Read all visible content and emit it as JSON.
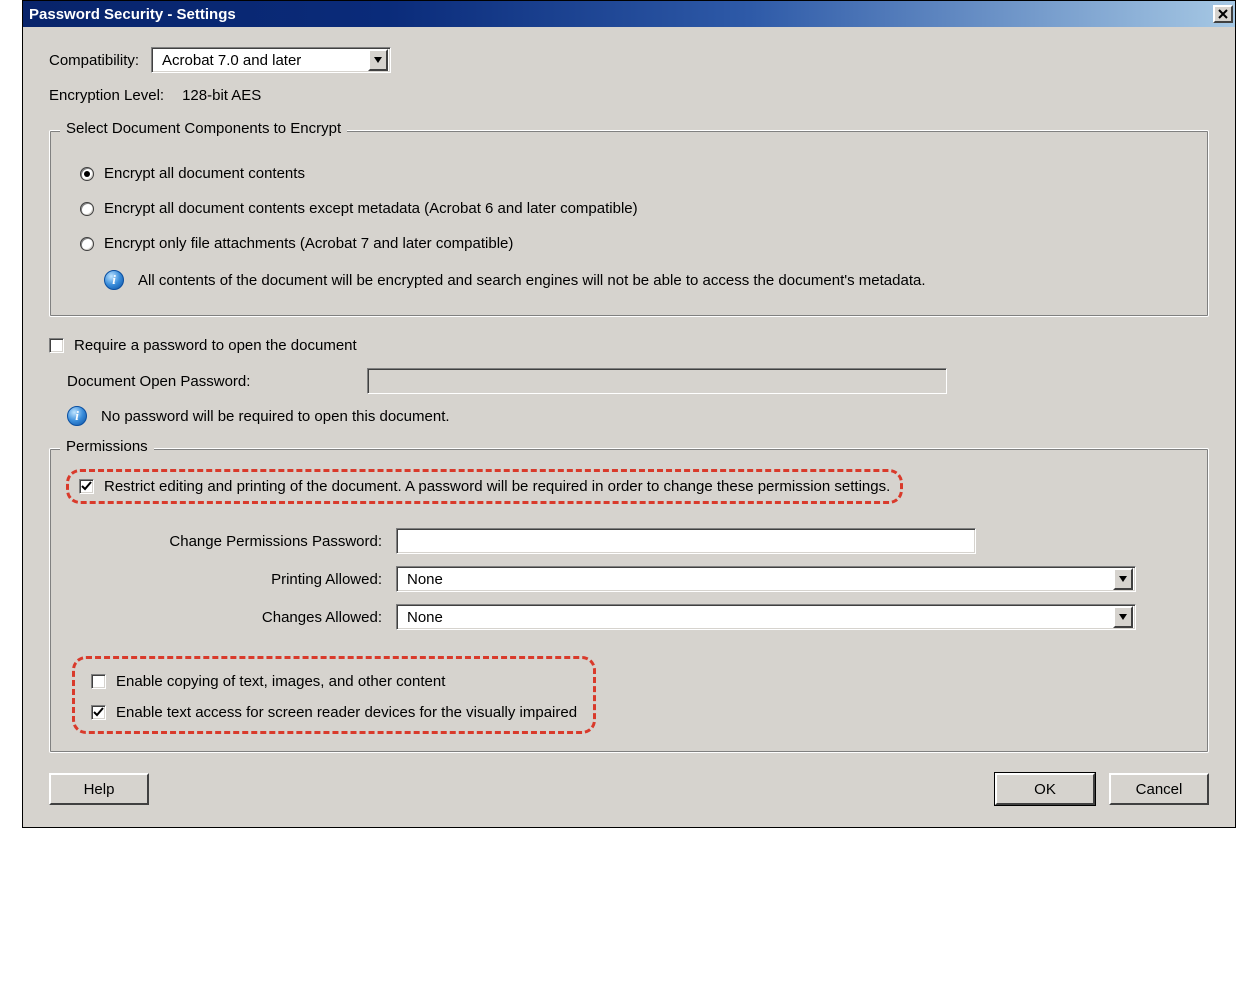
{
  "window": {
    "title": "Password Security - Settings"
  },
  "compatibility": {
    "label": "Compatibility:",
    "value": "Acrobat 7.0 and later"
  },
  "encryption": {
    "label": "Encryption  Level:",
    "value": "128-bit AES"
  },
  "encrypt_group": {
    "legend": "Select Document Components to Encrypt",
    "opt_all": "Encrypt all document contents",
    "opt_except_meta": "Encrypt all document contents except metadata (Acrobat 6 and later compatible)",
    "opt_attachments": "Encrypt only file attachments (Acrobat 7 and later compatible)",
    "info": "All contents of the document will be encrypted and search engines will not be able to access the document's metadata."
  },
  "open_pw": {
    "require_label": "Require a password to open the document",
    "field_label": "Document Open Password:",
    "info": "No password will be required to open this document."
  },
  "permissions": {
    "legend": "Permissions",
    "restrict_label": "Restrict editing and printing of the document. A password will be required in order to change these permission settings.",
    "change_pw_label": "Change Permissions Password:",
    "printing_label": "Printing Allowed:",
    "printing_value": "None",
    "changes_label": "Changes Allowed:",
    "changes_value": "None",
    "enable_copy_label": "Enable copying of text, images, and other content",
    "enable_access_label": "Enable text access for screen reader devices for the visually impaired"
  },
  "buttons": {
    "help": "Help",
    "ok": "OK",
    "cancel": "Cancel"
  }
}
